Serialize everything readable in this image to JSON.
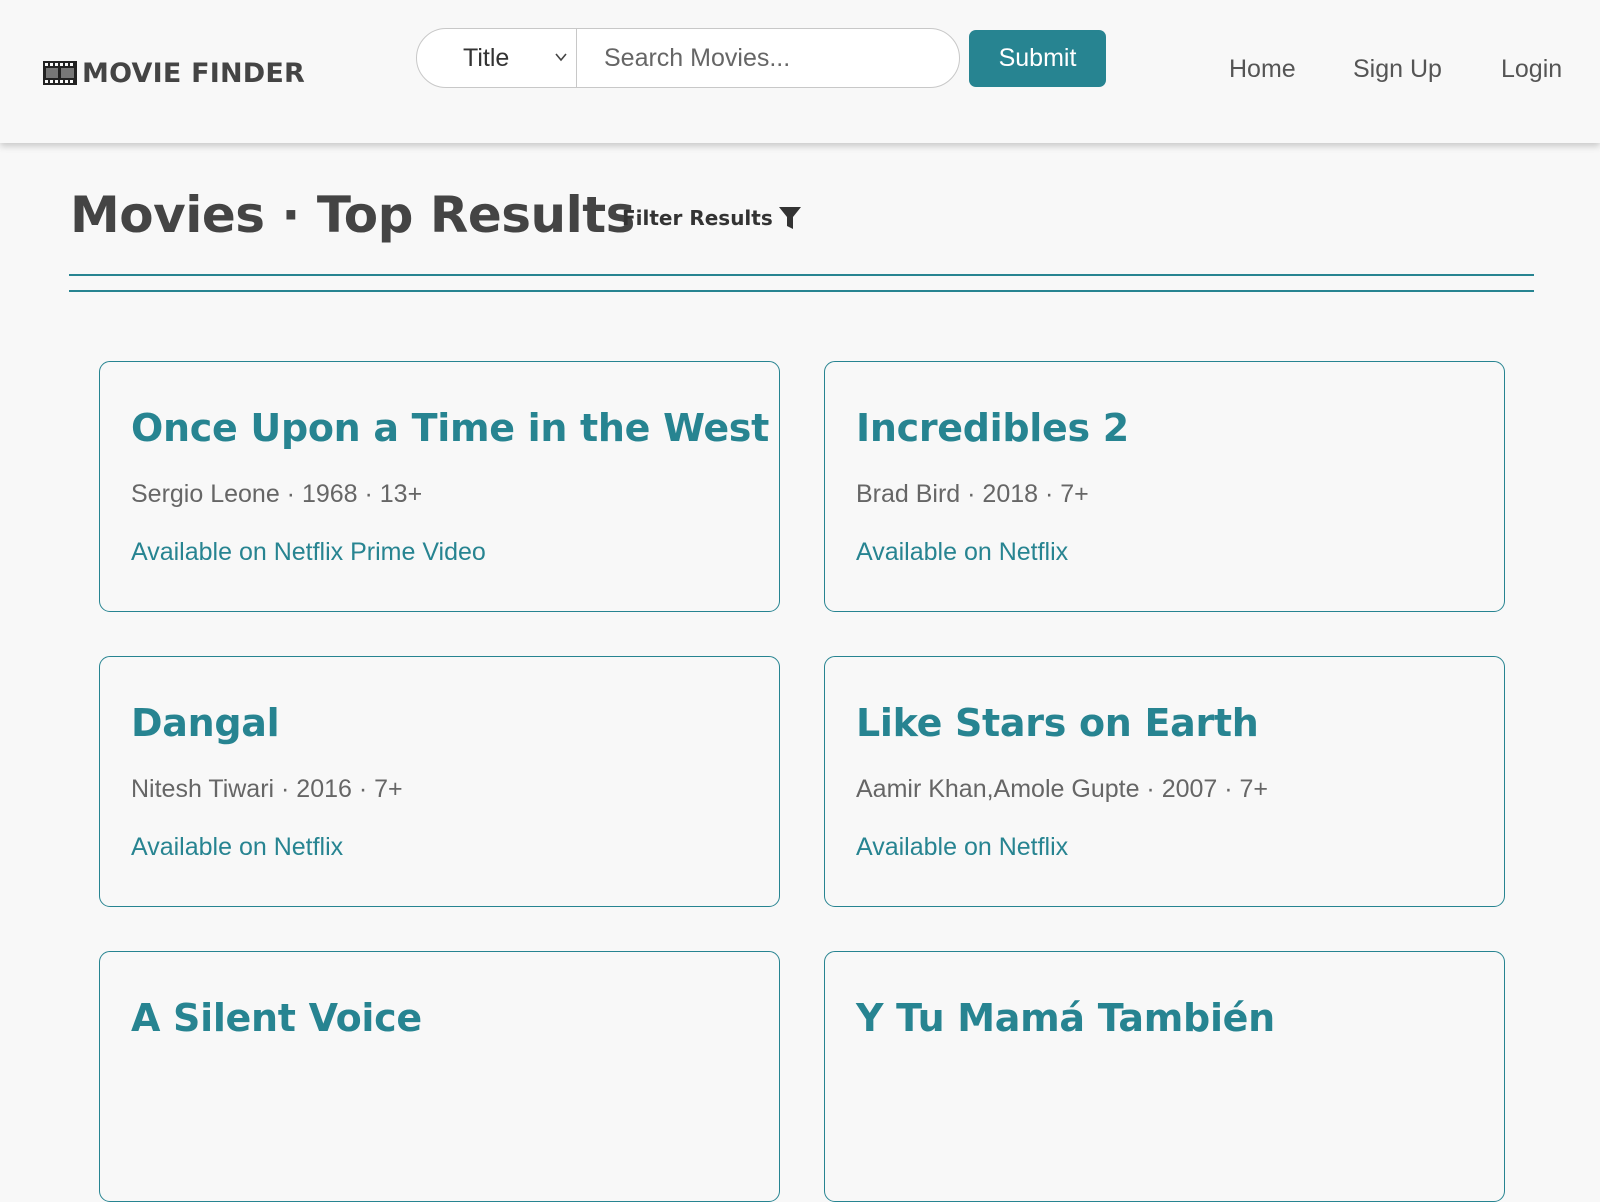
{
  "brand": {
    "label": "MOVIE FINDER",
    "icon": "film-icon"
  },
  "search": {
    "field_selected": "Title",
    "placeholder": "Search Movies...",
    "submit_label": "Submit"
  },
  "nav": {
    "home": "Home",
    "sign_up": "Sign Up",
    "login": "Login"
  },
  "page": {
    "title": "Movies · Top Results",
    "filter_label": "Filter Results",
    "filter_icon": "filter-funnel-icon"
  },
  "colors": {
    "accent": "#278491",
    "background": "#f8f8f8",
    "heading": "#444444"
  },
  "movies": [
    {
      "title": "Once Upon a Time in the West",
      "meta": "Sergio Leone · 1968 · 13+",
      "availability": "Available on Netflix Prime Video"
    },
    {
      "title": "Incredibles 2",
      "meta": "Brad Bird · 2018 · 7+",
      "availability": "Available on Netflix"
    },
    {
      "title": "Dangal",
      "meta": "Nitesh Tiwari · 2016 · 7+",
      "availability": "Available on Netflix"
    },
    {
      "title": "Like Stars on Earth",
      "meta": "Aamir Khan,Amole Gupte · 2007 · 7+",
      "availability": "Available on Netflix"
    },
    {
      "title": "A Silent Voice"
    },
    {
      "title": "Y Tu Mamá También"
    }
  ]
}
